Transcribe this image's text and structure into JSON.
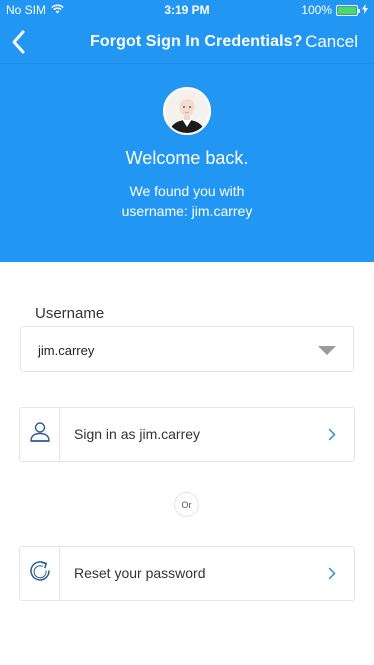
{
  "status_bar": {
    "carrier": "No SIM",
    "time": "3:19 PM",
    "battery_text": "100%",
    "battery_level": 1.0
  },
  "nav": {
    "back_icon": "chevron-left-icon",
    "title": "Forgot Sign In Credentials?",
    "cancel": "Cancel"
  },
  "hero": {
    "welcome": "Welcome back.",
    "found_line1": "We found you with",
    "found_line2": "username: jim.carrey"
  },
  "form": {
    "username_label": "Username",
    "username_value": "jim.carrey"
  },
  "actions": {
    "sign_in_label": "Sign in as jim.carrey",
    "or_text": "Or",
    "reset_label": "Reset your password"
  },
  "colors": {
    "brand_blue": "#2196f3",
    "battery_green": "#4cd964",
    "icon_blue": "#2a5d8f",
    "chevron_blue": "#1e88e5"
  }
}
